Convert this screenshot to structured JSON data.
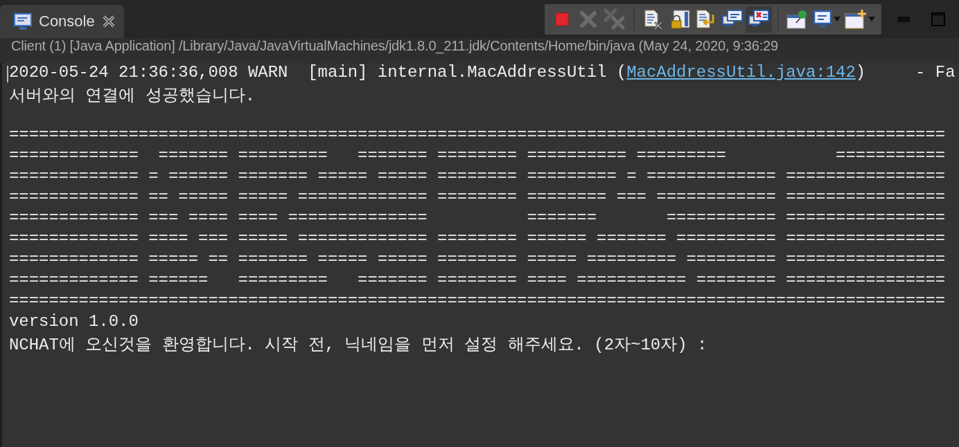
{
  "tab": {
    "label": "Console",
    "selected": true
  },
  "toolbar": [
    {
      "kind": "terminate",
      "disabled": false,
      "selected": false
    },
    {
      "kind": "remove-launch",
      "disabled": true,
      "selected": false
    },
    {
      "kind": "remove-all",
      "disabled": true,
      "selected": false
    },
    {
      "kind": "separator"
    },
    {
      "kind": "clear",
      "disabled": false,
      "selected": false
    },
    {
      "kind": "scroll-lock",
      "disabled": false,
      "selected": false
    },
    {
      "kind": "word-wrap",
      "disabled": false,
      "selected": false
    },
    {
      "kind": "show-stdout",
      "disabled": false,
      "selected": false
    },
    {
      "kind": "show-stderr",
      "disabled": false,
      "selected": true
    },
    {
      "kind": "separator"
    },
    {
      "kind": "pin",
      "disabled": false,
      "selected": false
    },
    {
      "kind": "display-console",
      "disabled": false,
      "selected": false
    },
    {
      "kind": "open-console",
      "disabled": false,
      "selected": false
    }
  ],
  "description": "Client (1) [Java Application] /Library/Java/JavaVirtualMachines/jdk1.8.0_211.jdk/Contents/Home/bin/java (May 24, 2020, 9:36:29",
  "console": {
    "lines": [
      {
        "kind": "text",
        "segments": [
          {
            "kind": "text",
            "text": "2020-05-24 21:36:36,008 WARN  [main] internal.MacAddressUtil ("
          },
          {
            "kind": "link",
            "text": "MacAddressUtil.java:142"
          },
          {
            "kind": "text",
            "text": ")     - Fa"
          }
        ]
      },
      {
        "kind": "text",
        "segments": [
          {
            "kind": "text",
            "text": "서버와의 연결에 성공했습니다."
          }
        ]
      },
      {
        "kind": "blank"
      },
      {
        "kind": "text",
        "segments": [
          {
            "kind": "text",
            "text": "=============================================================================================="
          }
        ]
      },
      {
        "kind": "text",
        "segments": [
          {
            "kind": "text",
            "text": "=============  ======= =========   ======= ======== ========== =========           ==========="
          }
        ]
      },
      {
        "kind": "text",
        "segments": [
          {
            "kind": "text",
            "text": "============= = ====== ======= ===== ===== ======== ========= = ============= ================"
          }
        ]
      },
      {
        "kind": "text",
        "segments": [
          {
            "kind": "text",
            "text": "============= == ===== ===== ============= ======== ======== === ============ ================"
          }
        ]
      },
      {
        "kind": "text",
        "segments": [
          {
            "kind": "text",
            "text": "============= === ==== ==== ==============          =======       =========== ================"
          }
        ]
      },
      {
        "kind": "text",
        "segments": [
          {
            "kind": "text",
            "text": "============= ==== === ===== ============= ======== ====== ======= ========== ================"
          }
        ]
      },
      {
        "kind": "text",
        "segments": [
          {
            "kind": "text",
            "text": "============= ===== == ======= ===== ===== ======== ===== ========= ========= ================"
          }
        ]
      },
      {
        "kind": "text",
        "segments": [
          {
            "kind": "text",
            "text": "============= ======   =========   ======= ======== ==== =========== ======== ================"
          }
        ]
      },
      {
        "kind": "text",
        "segments": [
          {
            "kind": "text",
            "text": "=============================================================================================="
          }
        ]
      },
      {
        "kind": "text",
        "segments": [
          {
            "kind": "text",
            "text": "version 1.0.0"
          }
        ]
      },
      {
        "kind": "text",
        "segments": [
          {
            "kind": "text",
            "text": "NCHAT에 오신것을 환영합니다. 시작 전, 닉네임을 먼저 설정 해주세요. (2자~10자) :"
          }
        ]
      }
    ]
  }
}
